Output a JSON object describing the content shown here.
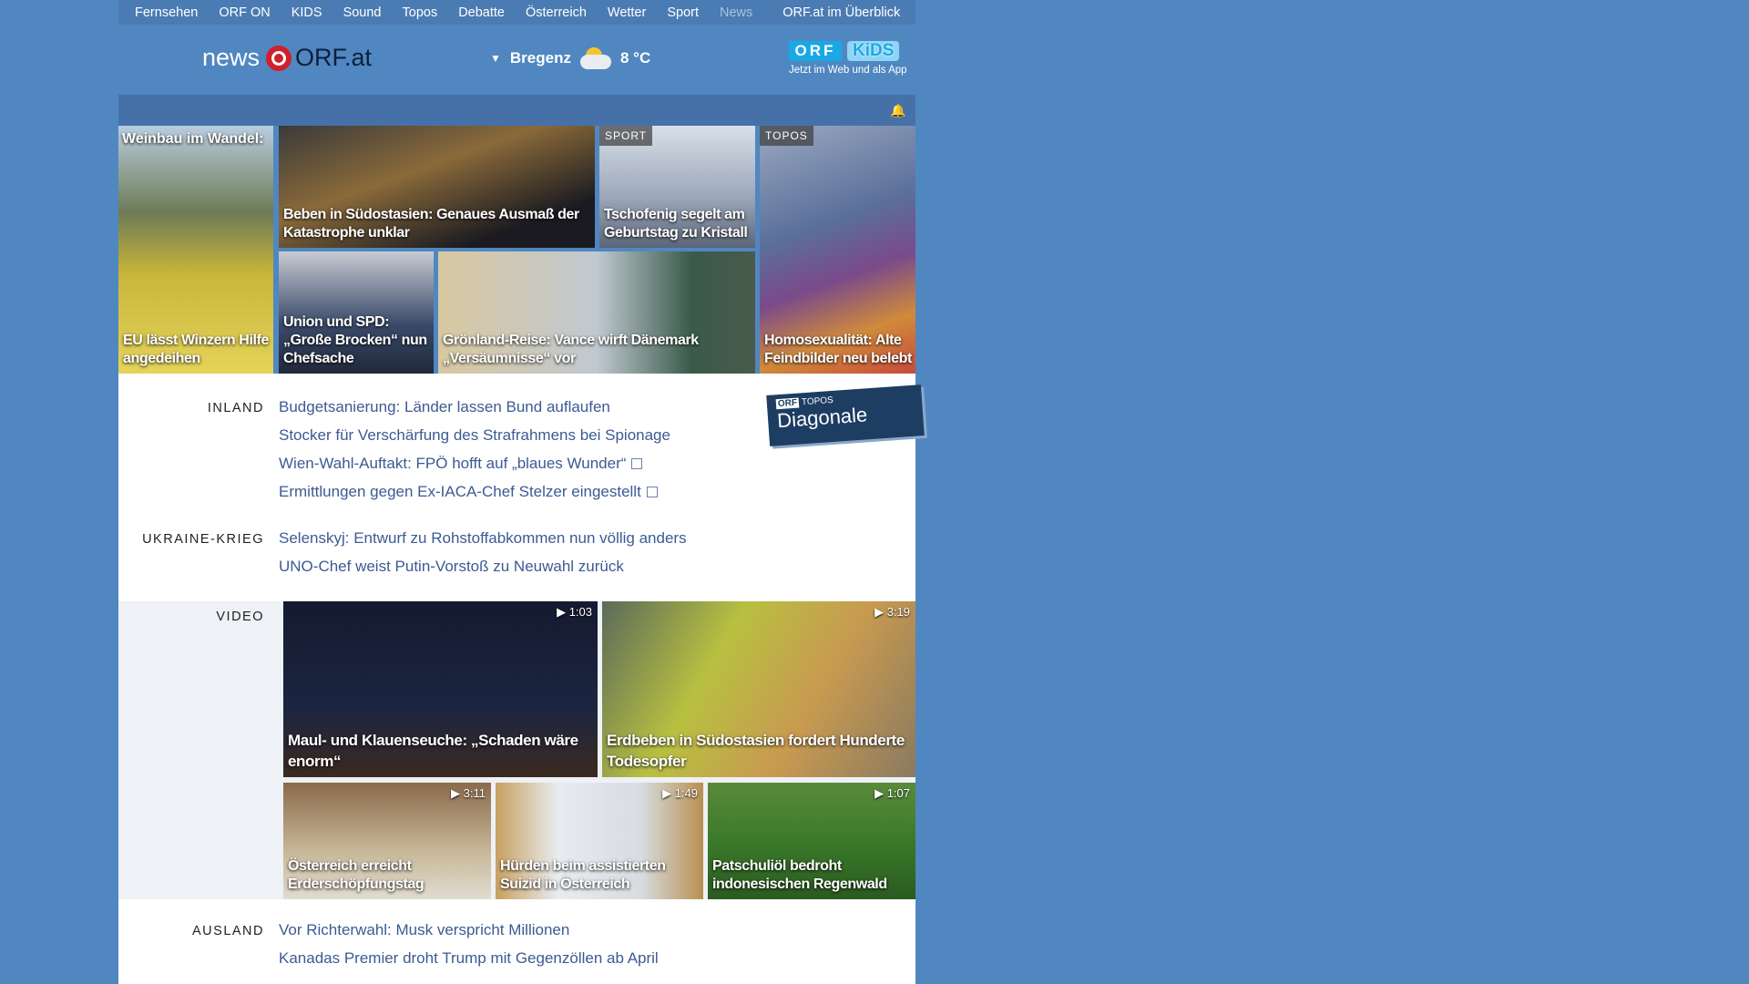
{
  "topnav": [
    "Fernsehen",
    "ORF ON",
    "KIDS",
    "Sound",
    "Topos",
    "Debatte",
    "Österreich",
    "Wetter",
    "Sport",
    "News"
  ],
  "topnav_overview": "ORF.at im Überblick",
  "logo": {
    "news": "news",
    "orf": "ORF.at"
  },
  "weather": {
    "arrow": "▼",
    "city": "Bregenz",
    "temp": "8 °C",
    "icon": "partly-cloudy-icon"
  },
  "kids": {
    "orf": "ORF",
    "kids": "KiDS",
    "sub": "Jetzt im Web und als App"
  },
  "bell": "🔔",
  "tiles": {
    "wein": {
      "top": "Weinbau im Wandel:",
      "cap": "EU lässt Winzern Hilfe angedeihen"
    },
    "beben": {
      "cap": "Beben in Südostasien: Genaues Ausmaß der Katastrophe unklar"
    },
    "sport": {
      "label": "SPORT",
      "cap": "Tschofenig segelt am Geburtstag zu Kristall"
    },
    "topos": {
      "label": "TOPOS",
      "cap": "Homosexualität: Alte Feindbilder neu belebt"
    },
    "union": {
      "cap": "Union und SPD: „Große Brocken“ nun Chefsache"
    },
    "groenland": {
      "cap": "Grönland-Reise: Vance wirft Dänemark „Versäumnisse“ vor"
    }
  },
  "diagonale": {
    "orf": "ORF",
    "topos": "TOPOS",
    "title": "Diagonale"
  },
  "inland": {
    "label": "INLAND",
    "links": [
      "Budgetsanierung: Länder lassen Bund auflaufen",
      "Stocker für Verschärfung des Strafrahmens bei Spionage",
      "Wien-Wahl-Auftakt: FPÖ hofft auf „blaues Wunder“",
      "Ermittlungen gegen Ex-IACA-Chef Stelzer eingestellt"
    ]
  },
  "ukraine": {
    "label": "UKRAINE-KRIEG",
    "links": [
      "Selenskyj: Entwurf zu Rohstoffabkommen nun völlig anders",
      "UNO-Chef weist Putin-Vorstoß zu Neuwahl zurück"
    ]
  },
  "video": {
    "label": "VIDEO",
    "items": [
      {
        "cap": "Maul- und Klauenseuche: „Schaden wäre enorm“",
        "dur": "1:03"
      },
      {
        "cap": "Erdbeben in Südostasien fordert Hunderte Todesopfer",
        "dur": "3:19"
      },
      {
        "cap": "Österreich erreicht Erderschöpfungstag",
        "dur": "3:11"
      },
      {
        "cap": "Hürden beim assistierten Suizid in Österreich",
        "dur": "1:49"
      },
      {
        "cap": "Patschuliöl bedroht indonesischen Regenwald",
        "dur": "1:07"
      }
    ]
  },
  "ausland": {
    "label": "AUSLAND",
    "links": [
      "Vor Richterwahl: Musk verspricht Millionen",
      "Kanadas Premier droht Trump mit Gegenzöllen ab April"
    ]
  }
}
